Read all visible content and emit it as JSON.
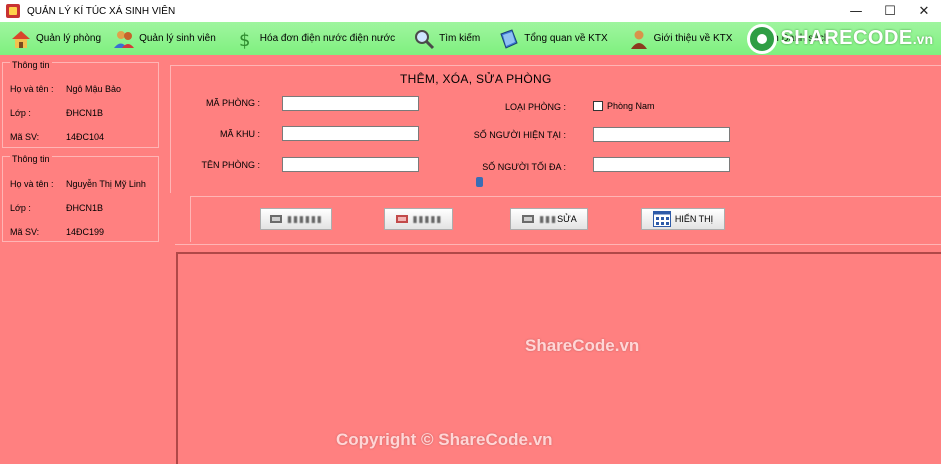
{
  "window": {
    "title": "QUẢN LÝ KÍ TÚC XÁ SINH VIÊN",
    "minimize": "—",
    "maximize": "☐",
    "close": "✕"
  },
  "menu": {
    "items": [
      {
        "label": "Quản lý phòng",
        "icon": "house-icon"
      },
      {
        "label": "Quản lý sinh viên",
        "icon": "users-icon"
      },
      {
        "label": "Hóa đơn điện nước điện nước",
        "icon": "dollar-icon"
      },
      {
        "label": "Tìm kiếm",
        "icon": "magnifier-icon"
      },
      {
        "label": "Tổng quan về KTX",
        "icon": "book-icon"
      },
      {
        "label": "Giới thiệu về KTX",
        "icon": "person-icon"
      },
      {
        "label": "In Danh sách",
        "icon": "print-icon"
      }
    ]
  },
  "logo": {
    "text": "SHARECODE",
    "tld": ".vn"
  },
  "info_boxes": [
    {
      "legend": "Thông tin",
      "rows": [
        {
          "label": "Họ và tên :",
          "value": "Ngô Mậu Bảo"
        },
        {
          "label": "Lớp :",
          "value": "ĐHCN1B"
        },
        {
          "label": "Mã SV:",
          "value": "14ĐC104"
        }
      ]
    },
    {
      "legend": "Thông tin",
      "rows": [
        {
          "label": "Họ và tên :",
          "value": "Nguyễn Thị Mỹ Linh"
        },
        {
          "label": "Lớp :",
          "value": "ĐHCN1B"
        },
        {
          "label": "Mã SV:",
          "value": "14ĐC199"
        }
      ]
    }
  ],
  "form": {
    "heading": "THÊM, XÓA, SỬA PHÒNG",
    "ma_phong_label": "MÃ PHÒNG :",
    "ma_khu_label": "MÃ KHU :",
    "ten_phong_label": "TÊN PHÒNG :",
    "loai_phong_label": "LOẠI PHÒNG :",
    "so_nguoi_hien_tai_label": "SỐ NGƯỜI HIỆN TẠI :",
    "so_nguoi_toi_da_label": "SỐ NGƯỜI TỐI ĐA :",
    "phong_nam_label": "Phòng Nam",
    "ma_phong": "",
    "ma_khu": "",
    "ten_phong": "",
    "so_nguoi_hien_tai": "",
    "so_nguoi_toi_da": ""
  },
  "buttons": {
    "btn1": "▮▮▮▮▮▮",
    "btn2": "▮▮▮▮▮",
    "btn3_prefix": "▮▮▮",
    "btn3_suffix": "SỬA",
    "btn4": "HIỂN THỊ"
  },
  "watermark": {
    "center": "ShareCode.vn",
    "bottom": "Copyright © ShareCode.vn"
  },
  "colors": {
    "background": "#ff8080",
    "menubar": "#8ff28f",
    "grid_border": "#b04848"
  }
}
